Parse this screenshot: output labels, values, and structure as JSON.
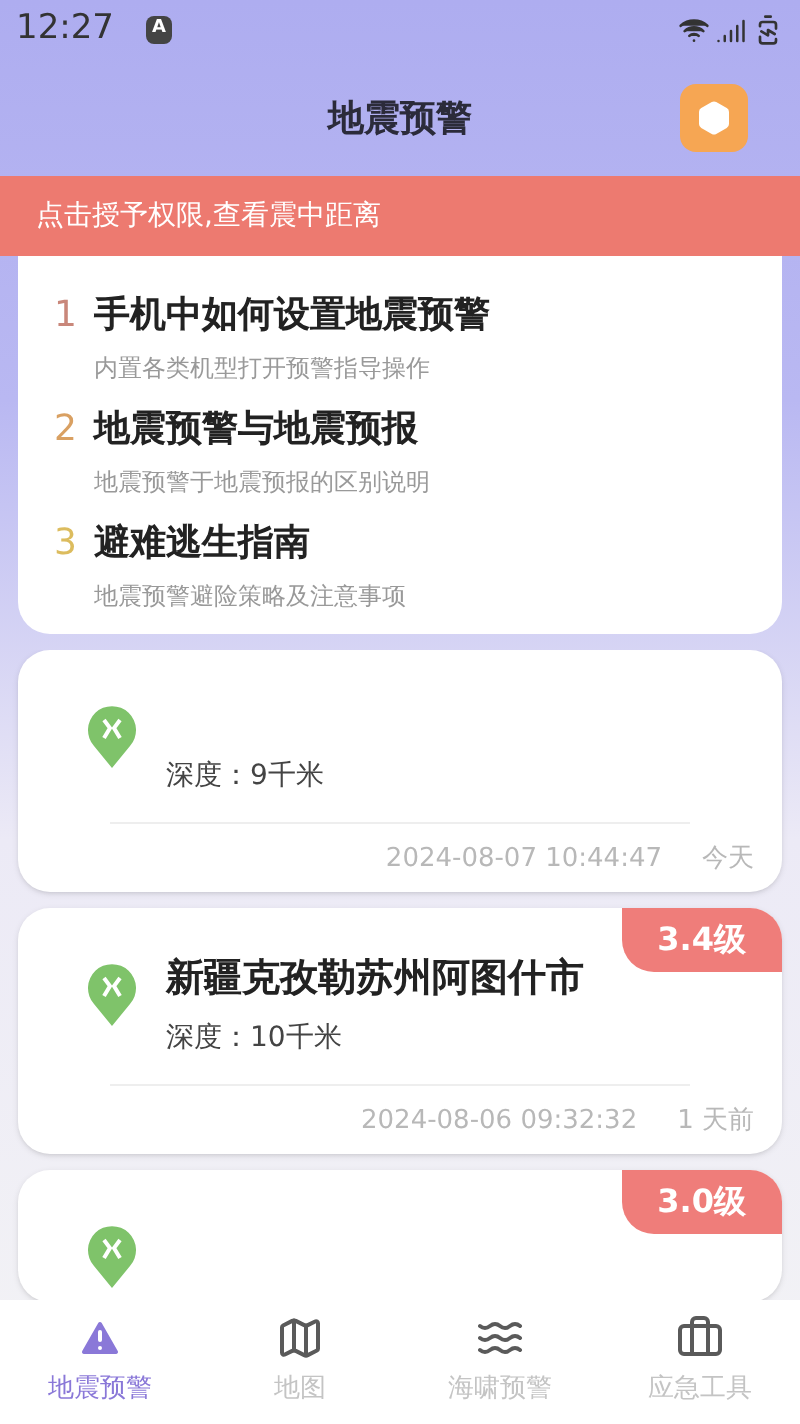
{
  "status_bar": {
    "time": "12:27",
    "badge": "A"
  },
  "header": {
    "title": "地震预警"
  },
  "notice": "点击授予权限,查看震中距离",
  "guides": [
    {
      "number": "1",
      "color": "#c9877a",
      "title": "手机中如何设置地震预警",
      "subtitle": "内置各类机型打开预警指导操作"
    },
    {
      "number": "2",
      "color": "#d9a062",
      "title": "地震预警与地震预报",
      "subtitle": "地震预警于地震预报的区别说明"
    },
    {
      "number": "3",
      "color": "#dcbc5e",
      "title": "避难逃生指南",
      "subtitle": "地震预警避险策略及注意事项"
    }
  ],
  "quakes": [
    {
      "depth": "深度：9千米",
      "time": "2024-08-07 10:44:47",
      "ago": "今天"
    },
    {
      "magnitude": "3.4级",
      "location": "新疆克孜勒苏州阿图什市",
      "depth": "深度：10千米",
      "time": "2024-08-06 09:32:32",
      "ago": "1 天前"
    },
    {
      "magnitude": "3.0级"
    }
  ],
  "tabs": [
    {
      "label": "地震预警",
      "selected": true
    },
    {
      "label": "地图",
      "selected": false
    },
    {
      "label": "海啸预警",
      "selected": false
    },
    {
      "label": "应急工具",
      "selected": false
    }
  ]
}
